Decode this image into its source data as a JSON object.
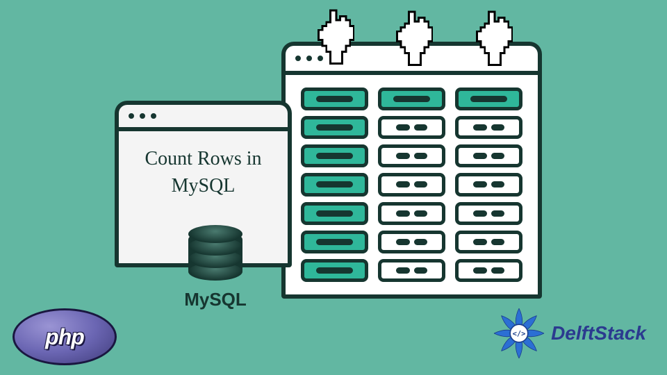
{
  "text_window": {
    "line1": "Count Rows in",
    "line2": "MySQL"
  },
  "mysql": {
    "label": "MySQL"
  },
  "php": {
    "label": "php"
  },
  "delftstack": {
    "label": "DelftStack"
  },
  "spreadsheet": {
    "rows": 7,
    "cols": 3,
    "teal_cells": [
      "r1c1",
      "r2c1",
      "r3c1",
      "r4c1",
      "r5c1",
      "r6c1",
      "r7c1",
      "r1c2",
      "r1c3"
    ]
  }
}
